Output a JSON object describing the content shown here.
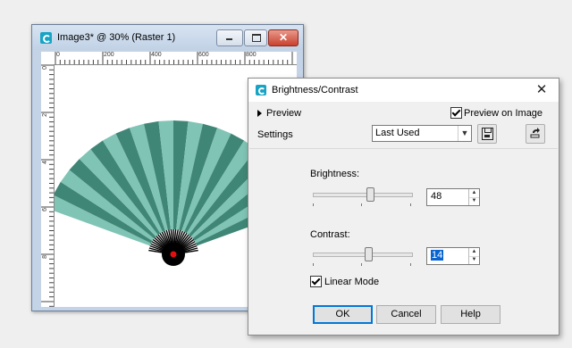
{
  "image_window": {
    "title": "Image3* @  30% (Raster 1)",
    "ruler_h_labels": [
      "0",
      "200",
      "400",
      "600",
      "800"
    ],
    "ruler_v_labels": [
      "0",
      "2",
      "4",
      "6",
      "8"
    ],
    "icons": [
      "app-icon",
      "minimize-icon",
      "maximize-icon",
      "close-icon"
    ],
    "fan_colors": {
      "blade_light": "#7fc4b4",
      "blade_dark": "#3f8676",
      "hub": "#000000",
      "pin": "#e01010"
    }
  },
  "dialog": {
    "title": "Brightness/Contrast",
    "close_glyph": "✕",
    "preview_label": "Preview",
    "preview_on_image_label": "Preview on Image",
    "preview_on_image_checked": true,
    "settings_label": "Settings",
    "settings_value": "Last Used",
    "brightness_label": "Brightness:",
    "brightness_value": "48",
    "contrast_label": "Contrast:",
    "contrast_value": "14",
    "linear_mode_label": "Linear Mode",
    "linear_mode_checked": true,
    "buttons": {
      "ok": "OK",
      "cancel": "Cancel",
      "help": "Help"
    },
    "accent_color": "#0078d7"
  }
}
